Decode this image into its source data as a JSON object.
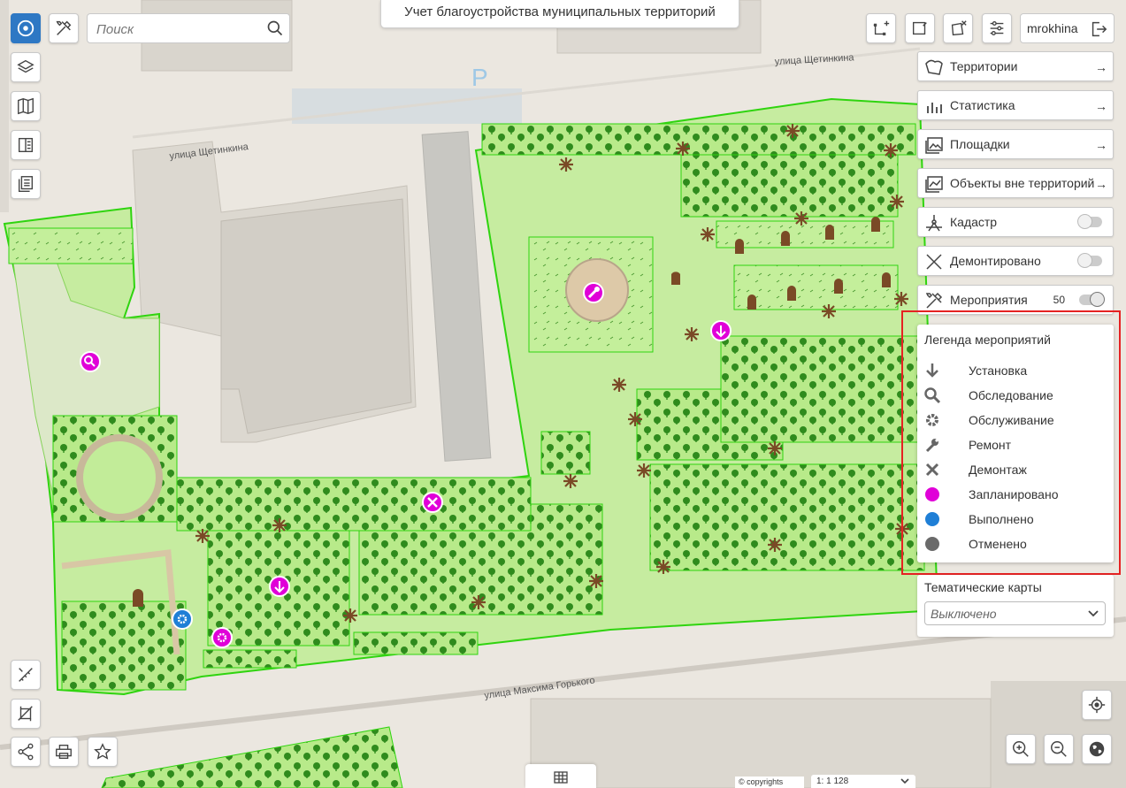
{
  "app": {
    "title": "Учет благоустройства муниципальных территорий",
    "user": "mrokhina"
  },
  "search": {
    "placeholder": "Поиск"
  },
  "streets": {
    "shchetinkina_1": "улица Щетинкина",
    "shchetinkina_2": "улица Щетинкина",
    "gorkogo": "улица Максима Горького"
  },
  "map_labels": {
    "parking": "P"
  },
  "panels": [
    {
      "label": "Территории",
      "icon": "territory-icon"
    },
    {
      "label": "Статистика",
      "icon": "bar-chart-icon"
    },
    {
      "label": "Площадки",
      "icon": "image-icon"
    },
    {
      "label": "Объекты вне территорий",
      "icon": "image-chart-icon"
    }
  ],
  "toggles": {
    "cadastre": {
      "label": "Кадастр",
      "on": false
    },
    "dismantled": {
      "label": "Демонтировано",
      "on": false
    },
    "events": {
      "label": "Мероприятия",
      "count": "50",
      "on": true
    }
  },
  "legend": {
    "title": "Легенда мероприятий",
    "items": [
      {
        "label": "Установка",
        "icon": "arrow-down-icon"
      },
      {
        "label": "Обследование",
        "icon": "magnifier-icon"
      },
      {
        "label": "Обслуживание",
        "icon": "gear-icon"
      },
      {
        "label": "Ремонт",
        "icon": "wrench-icon"
      },
      {
        "label": "Демонтаж",
        "icon": "cross-icon"
      },
      {
        "label": "Запланировано",
        "icon": "dot-icon",
        "color": "#e000d8"
      },
      {
        "label": "Выполнено",
        "icon": "dot-icon",
        "color": "#1f7fd6"
      },
      {
        "label": "Отменено",
        "icon": "dot-icon",
        "color": "#6a6a6a"
      }
    ]
  },
  "thematic": {
    "label": "Тематические карты",
    "value": "Выключено"
  },
  "footer": {
    "copyright": "© copyrights",
    "scale": "1: 1 128"
  },
  "colors": {
    "zone_fill": "#b6e98c",
    "zone_border": "#2fd40f",
    "tree": "#2d8a1c",
    "planned": "#e000d8",
    "done": "#1f7fd6",
    "bench": "#7a4a26"
  }
}
